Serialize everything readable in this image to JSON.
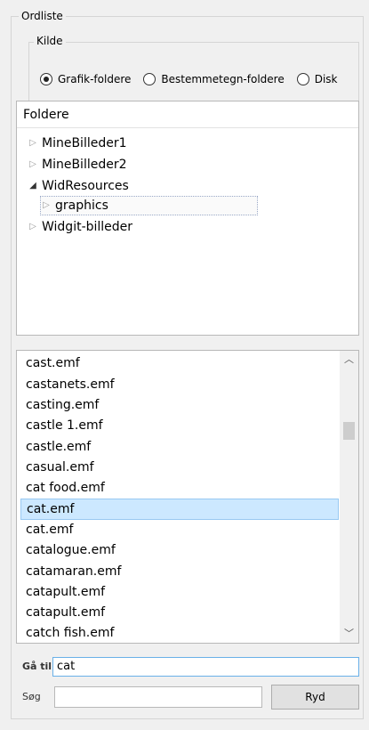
{
  "ordliste": {
    "title": "Ordliste"
  },
  "kilde": {
    "title": "Kilde",
    "options": [
      {
        "label": "Grafik-foldere",
        "checked": true
      },
      {
        "label": "Bestemmetegn-foldere",
        "checked": false
      },
      {
        "label": "Disk",
        "checked": false
      }
    ]
  },
  "tree": {
    "header": "Foldere",
    "items": [
      {
        "label": "MineBilleder1",
        "expanded": false
      },
      {
        "label": "MineBilleder2",
        "expanded": false
      },
      {
        "label": "WidResources",
        "expanded": true
      },
      {
        "label": "graphics",
        "expanded": false,
        "selected": true
      },
      {
        "label": "Widgit-billeder",
        "expanded": false
      }
    ]
  },
  "filelist": {
    "items": [
      "cast.emf",
      "castanets.emf",
      "casting.emf",
      "castle 1.emf",
      "castle.emf",
      "casual.emf",
      "cat food.emf",
      "cat.emf",
      "cat.emf",
      "catalogue.emf",
      "catamaran.emf",
      "catapult.emf",
      "catapult.emf",
      "catch fish.emf"
    ],
    "selected_index": 7
  },
  "goto": {
    "label": "Gå til",
    "value": "cat"
  },
  "search": {
    "label": "Søg",
    "value": ""
  },
  "clear_button": {
    "label": "Ryd"
  },
  "icons": {
    "scroll_up": "chevron-up-icon",
    "scroll_down": "chevron-down-icon",
    "tree_collapsed": "triangle-right-icon",
    "tree_expanded": "triangle-down-icon"
  }
}
